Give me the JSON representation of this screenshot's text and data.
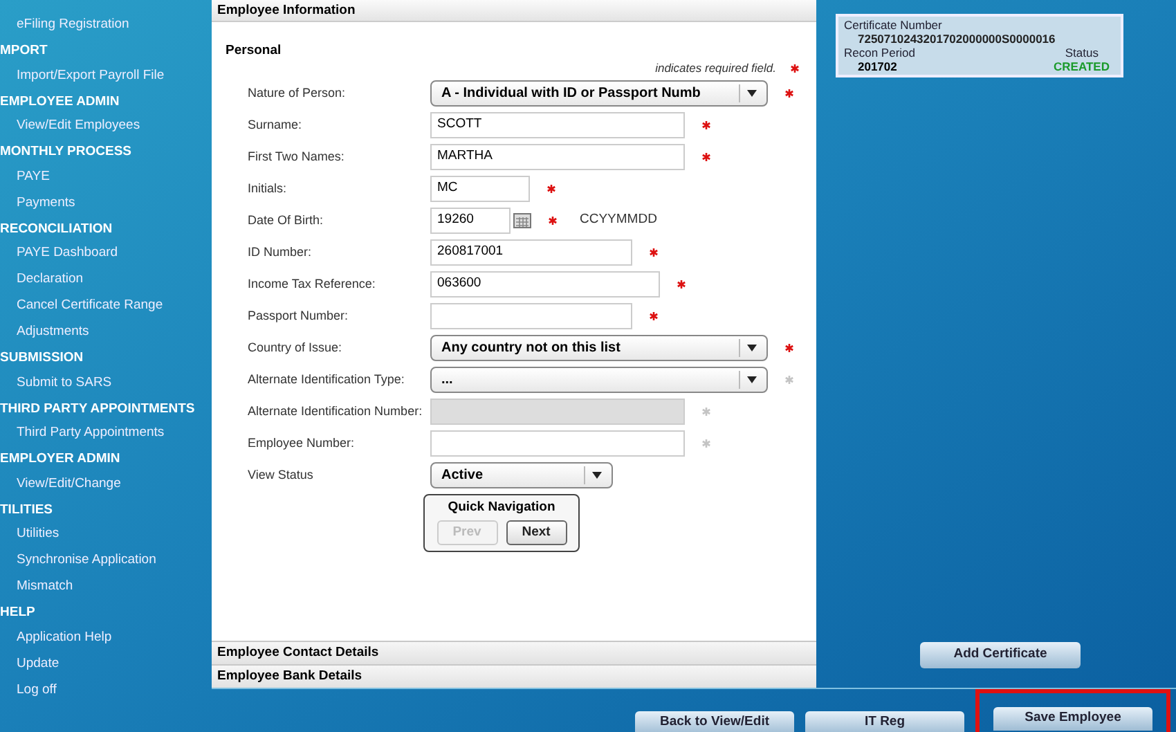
{
  "sidebar": {
    "sections": [
      {
        "items": [
          "eFiling Registration"
        ]
      },
      {
        "heading": "MPORT",
        "items": [
          "Import/Export Payroll File"
        ]
      },
      {
        "heading": "EMPLOYEE ADMIN",
        "items": [
          "View/Edit Employees"
        ]
      },
      {
        "heading": "MONTHLY PROCESS",
        "items": [
          "PAYE",
          "Payments"
        ]
      },
      {
        "heading": "RECONCILIATION",
        "items": [
          "PAYE Dashboard",
          "Declaration",
          "Cancel Certificate Range",
          "Adjustments"
        ]
      },
      {
        "heading": "SUBMISSION",
        "items": [
          "Submit to SARS"
        ]
      },
      {
        "heading": "THIRD PARTY APPOINTMENTS",
        "items": [
          "Third Party Appointments"
        ]
      },
      {
        "heading": "EMPLOYER ADMIN",
        "items": [
          "View/Edit/Change"
        ]
      },
      {
        "heading": "TILITIES",
        "items": [
          "Utilities",
          "Synchronise Application",
          "Mismatch"
        ]
      },
      {
        "heading": "HELP",
        "items": [
          "Application Help",
          "Update",
          "Log off"
        ]
      }
    ]
  },
  "panel": {
    "title": "Employee Information",
    "section": "Personal",
    "required_note": "indicates required field.",
    "fields": [
      {
        "kind": "select",
        "label": "Nature of Person:",
        "value": "A - Individual with ID or Passport Numb",
        "required": true
      },
      {
        "kind": "input",
        "label": "Surname:",
        "value": "SCOTT",
        "required": true
      },
      {
        "kind": "input",
        "label": "First Two Names:",
        "value": "MARTHA",
        "required": true
      },
      {
        "kind": "input",
        "label": "Initials:",
        "value": "MC",
        "required": true
      },
      {
        "kind": "date",
        "label": "Date Of Birth:",
        "value": "19260",
        "required": true,
        "hint": "CCYYMMDD"
      },
      {
        "kind": "input",
        "label": "ID Number:",
        "value": "260817001",
        "required": true
      },
      {
        "kind": "input",
        "label": "Income Tax Reference:",
        "value": "063600",
        "required": true
      },
      {
        "kind": "input",
        "label": "Passport Number:",
        "required": true
      },
      {
        "kind": "select",
        "label": "Country of Issue:",
        "value": "Any country not on this list",
        "required": true
      },
      {
        "kind": "select",
        "label": "Alternate Identification Type:",
        "value": "...",
        "required": false
      },
      {
        "kind": "disabled",
        "label": "Alternate Identification Number:",
        "required": false
      },
      {
        "kind": "input",
        "label": "Employee Number:",
        "required": false
      },
      {
        "kind": "select",
        "label": "View Status",
        "value": "Active"
      }
    ],
    "quick_navigation": {
      "title": "Quick Navigation",
      "buttons": [
        {
          "label": "Prev",
          "disabled": true
        },
        {
          "label": "Next",
          "disabled": false
        }
      ]
    },
    "collapsed_sections": [
      "Employee Contact Details",
      "Employee Bank Details"
    ]
  },
  "certificate": {
    "number_label": "Certificate Number",
    "number": "7250710243201702000000S0000016",
    "period_label": "Recon Period",
    "period": "201702",
    "status_label": "Status",
    "status": "CREATED"
  },
  "add_certificate": "Add Certificate",
  "footer_buttons": [
    {
      "label": "Back to View/Edit",
      "highlighted": false
    },
    {
      "label": "IT Reg",
      "highlighted": false
    },
    {
      "label": "Save Employee",
      "highlighted": true
    }
  ]
}
